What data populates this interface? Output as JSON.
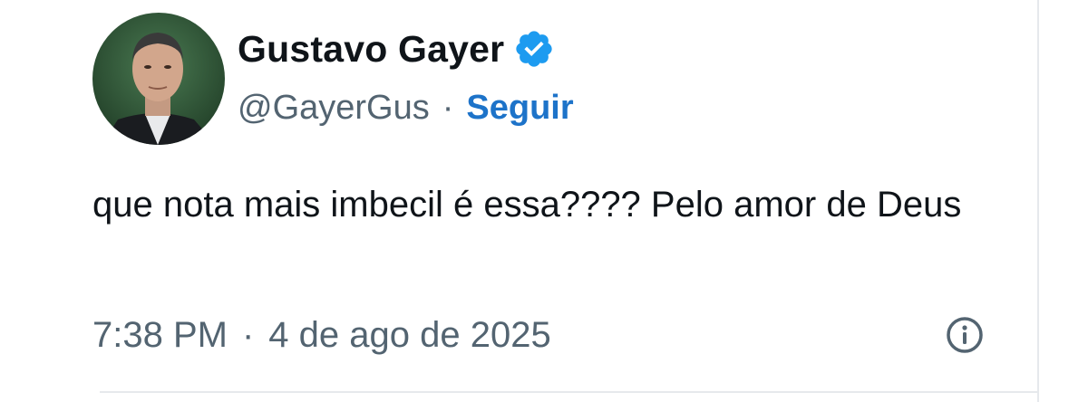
{
  "author": {
    "display_name": "Gustavo Gayer",
    "handle": "@GayerGus",
    "follow_label": "Seguir",
    "verified_icon": "verified-badge-icon",
    "avatar_icon": "avatar"
  },
  "tweet": {
    "text": "que nota mais imbecil é essa???? Pelo amor de Deus"
  },
  "meta": {
    "time": "7:38 PM",
    "separator": "·",
    "date": "4 de ago de 2025",
    "info_icon": "info-icon"
  },
  "colors": {
    "text_primary": "#0f1419",
    "text_secondary": "#536471",
    "link": "#1d73c9",
    "verified": "#1d9bf0",
    "divider": "#e6e9ec"
  }
}
